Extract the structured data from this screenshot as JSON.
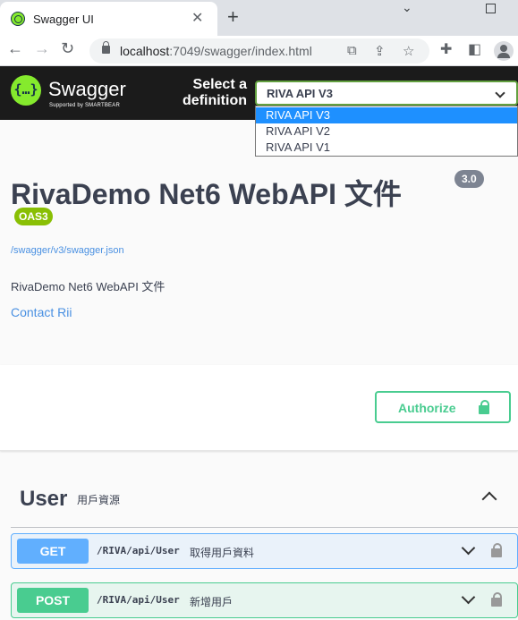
{
  "browser": {
    "tab_title": "Swagger UI",
    "tab_close": "✕",
    "new_tab": "+",
    "minimize": "⌄",
    "url_host": "localhost",
    "url_path": ":7049/swagger/index.html",
    "icons": {
      "back": "←",
      "forward": "→",
      "reload": "↻",
      "translate": "⧉",
      "share": "⇪",
      "bookmark": "☆",
      "extensions": "✚",
      "sidepanel": "◧"
    }
  },
  "topbar": {
    "logo_braces": "{…}",
    "logo_text": "Swagger",
    "logo_sub": "Supported by SMARTBEAR",
    "select_label": "Select a definition",
    "selected_definition": "RIVA API V3",
    "options": [
      "RIVA API V3",
      "RIVA API V2",
      "RIVA API V1"
    ]
  },
  "info": {
    "title": "RivaDemo Net6 WebAPI 文件",
    "version": "3.0",
    "oas": "OAS3",
    "spec_url": "/swagger/v3/swagger.json",
    "description": "RivaDemo Net6 WebAPI 文件",
    "contact": "Contact Rii"
  },
  "authorize": {
    "label": "Authorize"
  },
  "tag": {
    "name": "User",
    "description": "用戶資源"
  },
  "operations": [
    {
      "method": "GET",
      "path": "/RIVA/api/User",
      "summary": "取得用戶資料"
    },
    {
      "method": "POST",
      "path": "/RIVA/api/User",
      "summary": "新增用戶"
    }
  ],
  "colors": {
    "get": "#61affe",
    "post": "#49cc90",
    "topbar": "#1b1b1b",
    "swagger_green": "#85ea2d"
  }
}
